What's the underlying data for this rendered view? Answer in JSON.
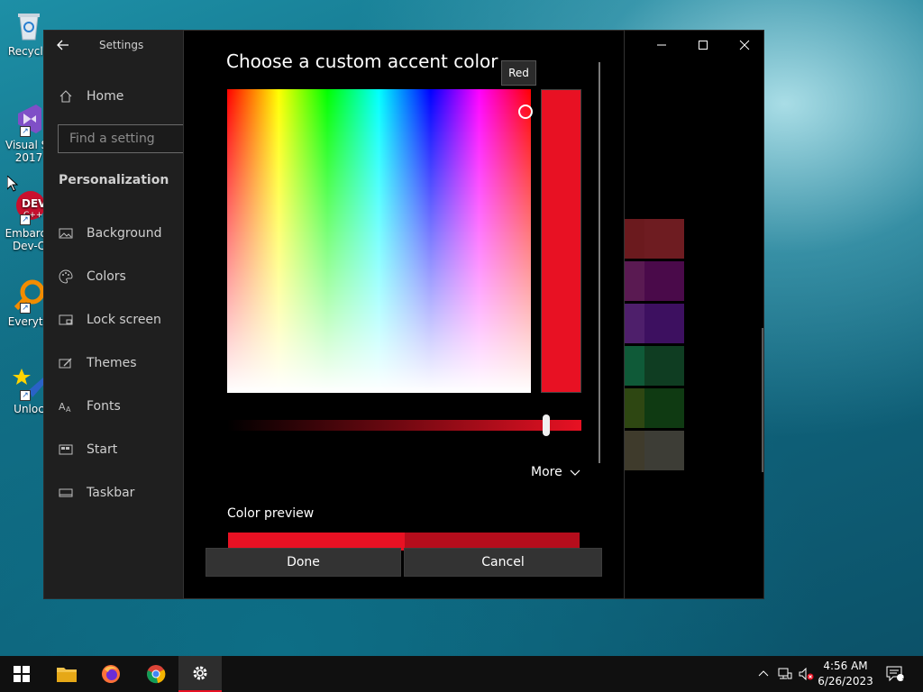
{
  "desktop": {
    "icons": [
      {
        "label": "Recycle",
        "icon": "recycle-bin-icon"
      },
      {
        "label": "Visual St",
        "label2": "2017",
        "icon": "visual-studio-icon"
      },
      {
        "label": "Embarca",
        "label2": "Dev-C",
        "icon": "devcpp-icon"
      },
      {
        "label": "Everyth",
        "icon": "everything-search-icon"
      },
      {
        "label": "Unloc",
        "icon": "unlocker-icon"
      }
    ]
  },
  "settings": {
    "app_title": "Settings",
    "search_placeholder": "Find a setting",
    "nav": {
      "home": "Home",
      "section": "Personalization",
      "items": [
        {
          "label": "Background",
          "icon": "picture-icon"
        },
        {
          "label": "Colors",
          "icon": "palette-icon"
        },
        {
          "label": "Lock screen",
          "icon": "lock-screen-icon"
        },
        {
          "label": "Themes",
          "icon": "themes-icon"
        },
        {
          "label": "Fonts",
          "icon": "fonts-icon"
        },
        {
          "label": "Start",
          "icon": "start-icon"
        },
        {
          "label": "Taskbar",
          "icon": "taskbar-icon"
        }
      ]
    },
    "swatch_colors": [
      "#6b1a1e",
      "#6e1c21",
      "#5a1a52",
      "#4a0a4a",
      "#4e1f6b",
      "#3d1060",
      "#0f5a38",
      "#0f3d22",
      "#2e4712",
      "#0f3a12",
      "#3f3b2c",
      "#3d3d36"
    ]
  },
  "dialog": {
    "title": "Choose a custom accent color",
    "tooltip": "Red",
    "selected_color": "#e81123",
    "value_level": 0.9,
    "more_label": "More",
    "preview_label": "Color preview",
    "done_label": "Done",
    "cancel_label": "Cancel"
  },
  "taskbar": {
    "apps": [
      "windows-start-icon",
      "file-explorer-icon",
      "firefox-icon",
      "chrome-icon",
      "settings-gear-icon"
    ],
    "time": "4:56 AM",
    "date": "6/26/2023",
    "notification_count": "1"
  }
}
